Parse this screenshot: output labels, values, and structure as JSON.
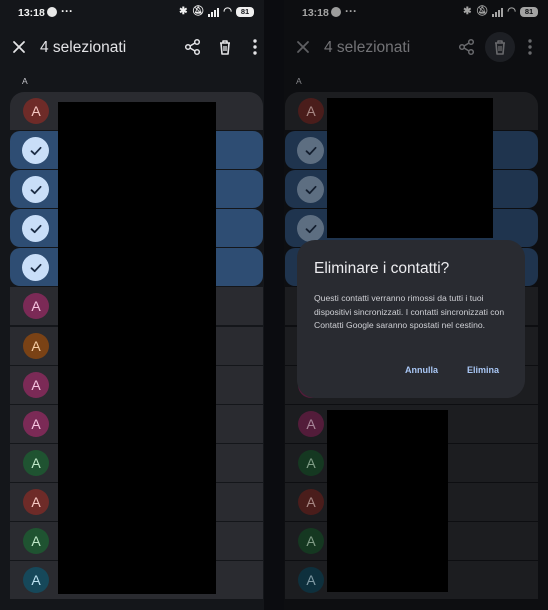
{
  "status_bar": {
    "time": "13:18",
    "overflow": "···",
    "battery": "81"
  },
  "toolbar": {
    "title": "4 selezionati"
  },
  "section_letter": "A",
  "contacts": [
    {
      "initial": "A",
      "selected": false,
      "avatar_bg": "#6e2b28",
      "avatar_fg": "#f7c9c4"
    },
    {
      "initial": "",
      "selected": true
    },
    {
      "initial": "",
      "selected": true
    },
    {
      "initial": "",
      "selected": true
    },
    {
      "initial": "",
      "selected": true
    },
    {
      "initial": "A",
      "selected": false,
      "avatar_bg": "#7b2a56",
      "avatar_fg": "#f7c4e0"
    },
    {
      "initial": "A",
      "selected": false,
      "avatar_bg": "#7a4215",
      "avatar_fg": "#f7cfa6"
    },
    {
      "initial": "A",
      "selected": false,
      "avatar_bg": "#7b2a56",
      "avatar_fg": "#f7c4e0"
    },
    {
      "initial": "A",
      "selected": false,
      "avatar_bg": "#7b2a56",
      "avatar_fg": "#f7c4e0"
    },
    {
      "initial": "A",
      "selected": false,
      "avatar_bg": "#1f5331",
      "avatar_fg": "#bfe8c8"
    },
    {
      "initial": "A",
      "selected": false,
      "avatar_bg": "#6e2b28",
      "avatar_fg": "#f7c9c4"
    },
    {
      "initial": "A",
      "selected": false,
      "avatar_bg": "#1f5331",
      "avatar_fg": "#bfe8c8"
    },
    {
      "initial": "A",
      "selected": false,
      "avatar_bg": "#16485a",
      "avatar_fg": "#bde3f2"
    }
  ],
  "dialog": {
    "title": "Eliminare i contatti?",
    "body": "Questi contatti verranno rimossi da tutti i tuoi dispositivi sincronizzati. I contatti sincronizzati con Contatti Google saranno spostati nel cestino.",
    "cancel": "Annulla",
    "confirm": "Elimina"
  },
  "colors": {
    "accent": "#a9c7f5",
    "selected_row": "#2e4d73",
    "row": "#2a2b30",
    "background": "#14161a"
  }
}
